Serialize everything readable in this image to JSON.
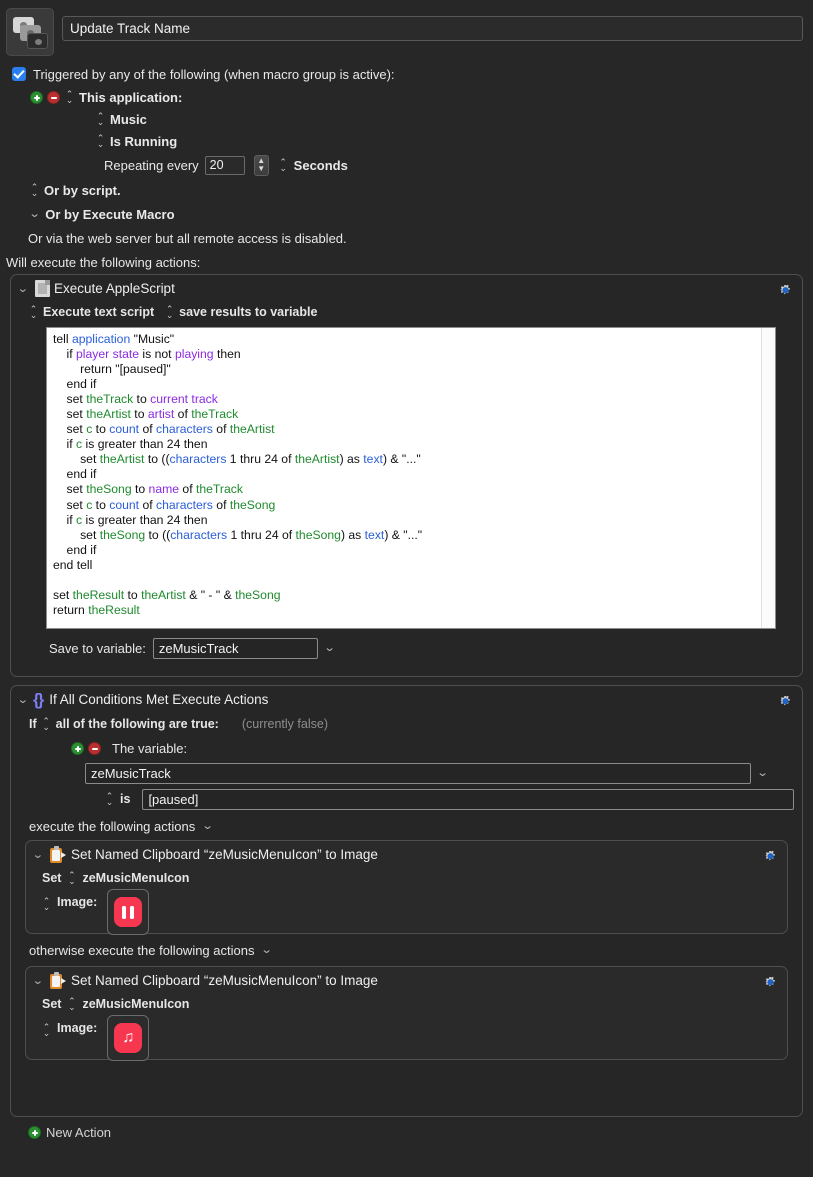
{
  "macro": {
    "icon_name": "macro-stack-icon",
    "title": "Update Track Name",
    "title_placeholder": "Macro Name"
  },
  "triggers": {
    "checkbox_checked": true,
    "header_label": "Triggered by any of the following (when macro group is active):",
    "application_trigger": {
      "label": "This application:",
      "app_name": "Music",
      "state": "Is Running",
      "repeat_label": "Repeating every",
      "repeat_value": "20",
      "repeat_unit": "Seconds"
    },
    "or_by_script": "Or by script.",
    "or_by_execute_macro": "Or by Execute Macro",
    "web_server_note": "Or via the web server but all remote access is disabled."
  },
  "actions_header": "Will execute the following actions:",
  "actions": [
    {
      "type": "applescript",
      "icon_name": "applescript-document-icon",
      "title": "Execute AppleScript",
      "mode_label": "Execute text script",
      "results_label": "save results to variable",
      "script_lines": [
        [
          [
            "tell ",
            "blk"
          ],
          [
            "application",
            "cmd"
          ],
          [
            " \"Music\"",
            "blk"
          ]
        ],
        [
          [
            "    if ",
            "blk"
          ],
          [
            "player state",
            "prop"
          ],
          [
            " is not ",
            "blk"
          ],
          [
            "playing",
            "prop"
          ],
          [
            " then",
            "blk"
          ]
        ],
        [
          [
            "        return \"[paused]\"",
            "blk"
          ]
        ],
        [
          [
            "    end if",
            "blk"
          ]
        ],
        [
          [
            "    set ",
            "blk"
          ],
          [
            "theTrack",
            "var"
          ],
          [
            " to ",
            "blk"
          ],
          [
            "current track",
            "prop"
          ]
        ],
        [
          [
            "    set ",
            "blk"
          ],
          [
            "theArtist",
            "var"
          ],
          [
            " to ",
            "blk"
          ],
          [
            "artist",
            "prop"
          ],
          [
            " of ",
            "blk"
          ],
          [
            "theTrack",
            "var"
          ]
        ],
        [
          [
            "    set ",
            "blk"
          ],
          [
            "c",
            "var"
          ],
          [
            " to ",
            "blk"
          ],
          [
            "count",
            "cmd"
          ],
          [
            " of ",
            "blk"
          ],
          [
            "characters",
            "cmd"
          ],
          [
            " of ",
            "blk"
          ],
          [
            "theArtist",
            "var"
          ]
        ],
        [
          [
            "    if ",
            "blk"
          ],
          [
            "c",
            "var"
          ],
          [
            " is greater than 24 then",
            "blk"
          ]
        ],
        [
          [
            "        set ",
            "blk"
          ],
          [
            "theArtist",
            "var"
          ],
          [
            " to ((",
            "blk"
          ],
          [
            "characters",
            "cmd"
          ],
          [
            " 1 thru 24 of ",
            "blk"
          ],
          [
            "theArtist",
            "var"
          ],
          [
            ") as ",
            "blk"
          ],
          [
            "text",
            "cmd"
          ],
          [
            ") & \"...\"",
            "blk"
          ]
        ],
        [
          [
            "    end if",
            "blk"
          ]
        ],
        [
          [
            "    set ",
            "blk"
          ],
          [
            "theSong",
            "var"
          ],
          [
            " to ",
            "blk"
          ],
          [
            "name",
            "prop"
          ],
          [
            " of ",
            "blk"
          ],
          [
            "theTrack",
            "var"
          ]
        ],
        [
          [
            "    set ",
            "blk"
          ],
          [
            "c",
            "var"
          ],
          [
            " to ",
            "blk"
          ],
          [
            "count",
            "cmd"
          ],
          [
            " of ",
            "blk"
          ],
          [
            "characters",
            "cmd"
          ],
          [
            " of ",
            "blk"
          ],
          [
            "theSong",
            "var"
          ]
        ],
        [
          [
            "    if ",
            "blk"
          ],
          [
            "c",
            "var"
          ],
          [
            " is greater than 24 then",
            "blk"
          ]
        ],
        [
          [
            "        set ",
            "blk"
          ],
          [
            "theSong",
            "var"
          ],
          [
            " to ((",
            "blk"
          ],
          [
            "characters",
            "cmd"
          ],
          [
            " 1 thru 24 of ",
            "blk"
          ],
          [
            "theSong",
            "var"
          ],
          [
            ") as ",
            "blk"
          ],
          [
            "text",
            "cmd"
          ],
          [
            ") & \"...\"",
            "blk"
          ]
        ],
        [
          [
            "    end if",
            "blk"
          ]
        ],
        [
          [
            "end tell",
            "blk"
          ]
        ],
        [
          [
            "",
            "blk"
          ]
        ],
        [
          [
            "set ",
            "blk"
          ],
          [
            "theResult",
            "var"
          ],
          [
            " to ",
            "blk"
          ],
          [
            "theArtist",
            "var"
          ],
          [
            " & \" - \" & ",
            "blk"
          ],
          [
            "theSong",
            "var"
          ]
        ],
        [
          [
            "return ",
            "blk"
          ],
          [
            "theResult",
            "var"
          ]
        ]
      ],
      "save_label": "Save to variable:",
      "save_variable": "zeMusicTrack"
    },
    {
      "type": "if-conditions",
      "icon_name": "braces-icon",
      "title": "If All Conditions Met Execute Actions",
      "if_label": "If",
      "condition_mode": "all of the following are true:",
      "currently_status": "(currently false)",
      "condition": {
        "kind_label": "The variable:",
        "variable": "zeMusicTrack",
        "operator": "is",
        "value": "[paused]"
      },
      "then_label": "execute the following actions",
      "else_label": "otherwise execute the following actions",
      "then_actions": [
        {
          "icon_name": "clipboard-icon",
          "title": "Set Named Clipboard “zeMusicMenuIcon” to Image",
          "set_label": "Set",
          "clipboard_name": "zeMusicMenuIcon",
          "image_label": "Image:",
          "image_icon": "pause-icon",
          "image_color": "#f7374f"
        }
      ],
      "else_actions": [
        {
          "icon_name": "clipboard-icon",
          "title": "Set Named Clipboard “zeMusicMenuIcon” to Image",
          "set_label": "Set",
          "clipboard_name": "zeMusicMenuIcon",
          "image_label": "Image:",
          "image_icon": "music-note-icon",
          "image_color": "#f7374f"
        }
      ]
    }
  ],
  "new_action_label": "New Action",
  "colors": {
    "background": "#272727",
    "panel": "#262626",
    "accent_blue": "#2a7ff0",
    "brace_purple": "#7b7df0",
    "icon_red": "#f7374f",
    "add_green": "#2d8f33",
    "remove_red": "#b8302f",
    "clipboard_orange": "#e08a2a"
  }
}
